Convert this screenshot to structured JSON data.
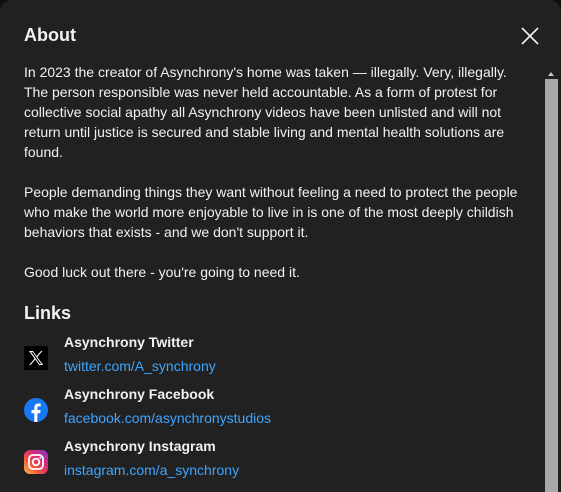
{
  "dialog": {
    "title": "About",
    "close_icon": "close-icon"
  },
  "description": {
    "paragraphs": [
      "In 2023 the creator of Asynchrony's home was taken — illegally. Very, illegally. The person responsible was never held accountable. As a form of protest for collective social apathy all Asynchrony videos have been unlisted and will not return until justice is secured and stable living and mental health solutions are found.",
      "People demanding things they want without feeling a need to protect the people who make the world more enjoyable to live in is one of the most deeply childish behaviors that exists - and we don't support it.",
      "Good luck out there - you're going to need it."
    ]
  },
  "links": {
    "heading": "Links",
    "items": [
      {
        "title": "Asynchrony Twitter",
        "url": "twitter.com/A_synchrony",
        "icon": "x-twitter-icon"
      },
      {
        "title": "Asynchrony Facebook",
        "url": "facebook.com/asynchronystudios",
        "icon": "facebook-icon"
      },
      {
        "title": "Asynchrony Instagram",
        "url": "instagram.com/a_synchrony",
        "icon": "instagram-icon"
      }
    ]
  },
  "colors": {
    "background": "#212121",
    "text": "#f1f1f1",
    "link": "#3ea6ff",
    "scrollbar_thumb": "#a8a8a8"
  }
}
